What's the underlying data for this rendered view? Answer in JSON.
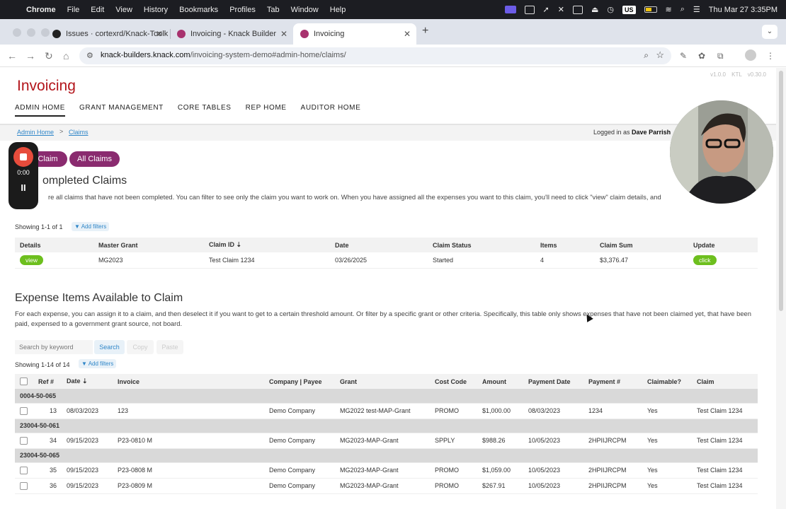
{
  "menubar": {
    "app": "Chrome",
    "items": [
      "File",
      "Edit",
      "View",
      "History",
      "Bookmarks",
      "Profiles",
      "Tab",
      "Window",
      "Help"
    ],
    "lang": "US",
    "datetime": "Thu Mar 27  3:35PM"
  },
  "tabs": [
    {
      "label": "Issues · cortexrd/Knack-Toolk",
      "icon": "github-icon"
    },
    {
      "label": "Invoicing - Knack Builder",
      "icon": "knack-icon"
    },
    {
      "label": "Invoicing",
      "icon": "knack-icon",
      "active": true
    }
  ],
  "address": {
    "host": "knack-builders.knack.com",
    "path": "/invoicing-system-demo#admin-home/claims/"
  },
  "app": {
    "version": "v1.0.0",
    "ktl": "KTL v0.30.0",
    "title": "Invoicing",
    "nav": [
      "ADMIN HOME",
      "GRANT MANAGEMENT",
      "CORE TABLES",
      "REP HOME",
      "AUDITOR HOME"
    ],
    "breadcrumb": {
      "home": "Admin Home",
      "sep": ">",
      "current": "Claims"
    },
    "logged_in": {
      "prefix": "Logged in as ",
      "name": "Dave Parrish"
    }
  },
  "actions": {
    "new_claim": "Claim",
    "all_claims": "All Claims"
  },
  "completed": {
    "title": "ompleted Claims",
    "desc": "re all claims that have not been completed. You can filter to see only the claim you want to work on. When you have assigned all the expenses you want to this claim, you'll need to click \"view\" claim details, and",
    "showing": "Showing 1-1 of 1",
    "add_filters": "Add filters",
    "columns": [
      "Details",
      "Master Grant",
      "Claim ID",
      "Date",
      "Claim Status",
      "Items",
      "Claim Sum",
      "Update"
    ],
    "row": {
      "details": "view",
      "grant": "MG2023",
      "claim_id": "Test Claim 1234",
      "date": "03/26/2025",
      "status": "Started",
      "items": "4",
      "sum": "$3,376.47",
      "update": "click"
    }
  },
  "expenses": {
    "title": "Expense Items Available to Claim",
    "desc": "For each expense, you can assign it to a claim, and then deselect it if you want to get to a certain threshold amount. Or filter by a specific grant or other criteria. Specifically, this table only shows expenses that have not been claimed yet, that have been paid, expensed to a government grant source, not board.",
    "search_placeholder": "Search by keyword",
    "search_btn": "Search",
    "copy_btn": "Copy",
    "paste_btn": "Paste",
    "showing": "Showing 1-14 of 14",
    "add_filters": "Add filters",
    "columns": [
      "Ref #",
      "Date",
      "Invoice",
      "Company | Payee",
      "Grant",
      "Cost Code",
      "Amount",
      "Payment Date",
      "Payment #",
      "Claimable?",
      "Claim"
    ],
    "groups": [
      "0004-50-065",
      "23004-50-061",
      "23004-50-065"
    ],
    "rows": [
      [
        "13",
        "08/03/2023",
        "123",
        "Demo Company",
        "MG2022 test-MAP-Grant",
        "PROMO",
        "$1,000.00",
        "08/03/2023",
        "1234",
        "Yes",
        "Test Claim 1234"
      ],
      [
        "34",
        "09/15/2023",
        "P23-0810 M",
        "Demo Company",
        "MG2023-MAP-Grant",
        "SPPLY",
        "$988.26",
        "10/05/2023",
        "2HPIIJRCPM",
        "Yes",
        "Test Claim 1234"
      ],
      [
        "35",
        "09/15/2023",
        "P23-0808 M",
        "Demo Company",
        "MG2023-MAP-Grant",
        "PROMO",
        "$1,059.00",
        "10/05/2023",
        "2HPIIJRCPM",
        "Yes",
        "Test Claim 1234"
      ],
      [
        "36",
        "09/15/2023",
        "P23-0809 M",
        "Demo Company",
        "MG2023-MAP-Grant",
        "PROMO",
        "$267.91",
        "10/05/2023",
        "2HPIIJRCPM",
        "Yes",
        "Test Claim 1234"
      ]
    ]
  },
  "recorder": {
    "time": "0:00",
    "pause": "II"
  }
}
